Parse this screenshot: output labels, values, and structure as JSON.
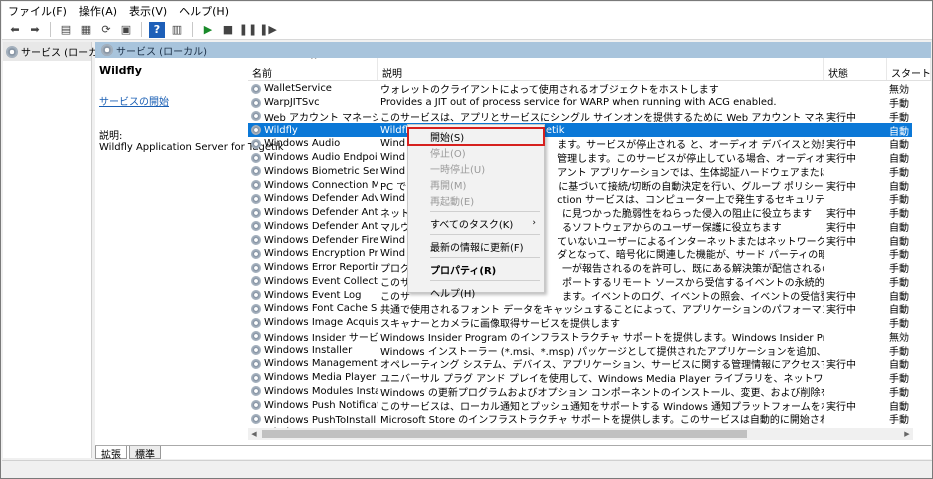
{
  "menubar": [
    "ファイル(F)",
    "操作(A)",
    "表示(V)",
    "ヘルプ(H)"
  ],
  "toolbar_icons": [
    "back-icon",
    "forward-icon",
    "console-tree-icon",
    "properties-list-icon",
    "refresh-icon",
    "export-icon",
    "help-icon",
    "show-icon",
    "start-icon",
    "stop-icon",
    "pause-icon",
    "restart-icon"
  ],
  "left_pane": {
    "label": "サービス (ローカル)"
  },
  "right_pane": {
    "header": "サービス (ローカル)"
  },
  "detail": {
    "title": "Wildfly",
    "start_link": "サービスの開始",
    "desc_label": "説明:",
    "desc_text": "Wildfly Application Server for Tagetik"
  },
  "columns": {
    "name": "名前",
    "desc": "説明",
    "status": "状態",
    "startup": "スタート"
  },
  "rows": [
    {
      "name": "WalletService",
      "desc": "ウォレットのクライアントによって使用されるオブジェクトをホストします",
      "status": "",
      "startup": "無効"
    },
    {
      "name": "WarpJITSvc",
      "desc": "Provides a JIT out of process service for WARP when running with ACG enabled.",
      "status": "",
      "startup": "手動 (ト"
    },
    {
      "name": "Web アカウント マネージャー",
      "desc": "このサービスは、アプリとサービスにシングル サインオンを提供するために Web アカウント マネージャーによって使用されます。",
      "status": "実行中",
      "startup": "手動 (ト"
    },
    {
      "name": "Wildfly",
      "desc": "Wildfly Application Server for Tagetik",
      "status": "",
      "startup": "自動"
    },
    {
      "name": "Windows Audio",
      "desc": "Wind",
      "tail": "ます。サービスが停止される と、オーディオ デバイスと効果は適切に機能しません。こ...",
      "status": "実行中",
      "startup": "自動"
    },
    {
      "name": "Windows Audio Endpoint B...",
      "desc": "Wind",
      "tail": "管理します。このサービスが停止している場合、オーディオ デバイスと効果は適切に機...",
      "status": "実行中",
      "startup": "自動"
    },
    {
      "name": "Windows Biometric Service",
      "desc": "Wind",
      "tail": "アント アプリケーションでは、生体認証ハードウェアまたはサンプルに直接アクセスせ...",
      "status": "",
      "startup": "手動 (ト"
    },
    {
      "name": "Windows Connection Mana...",
      "desc": "PC で",
      "tail": "に基づいて接続/切断の自動決定を行い、グループ ポリシー設定に基づいてネット...",
      "status": "実行中",
      "startup": "自動 (ト"
    },
    {
      "name": "Windows Defender Advance...",
      "desc": "Wind",
      "tail": "ction サービスは、コンピューター上で発生するセキュリティ イベントを監視および報告...",
      "status": "",
      "startup": "手動"
    },
    {
      "name": "Windows Defender Antivirus...",
      "desc": "ネット",
      "tail": "に見つかった脆弱性をねらった侵入の阻止に役立ちます",
      "status": "実行中",
      "startup": "手動"
    },
    {
      "name": "Windows Defender Antivirus...",
      "desc": "マルウ",
      "tail": "るソフトウェアからのユーザー保護に役立ちます",
      "status": "実行中",
      "startup": "自動"
    },
    {
      "name": "Windows Defender Firewall",
      "desc": "Wind",
      "tail": "ていないユーザーによるインターネットまたはネットワーク経由のアクセスを阻止するこ...",
      "status": "実行中",
      "startup": "自動"
    },
    {
      "name": "Windows Encryption Provid...",
      "desc": "Wind",
      "tail": "ダとなって、暗号化に関連した機能が、サード パーティの暗号化プロバイダーから、E...",
      "status": "",
      "startup": "手動 (ト"
    },
    {
      "name": "Windows Error Reporting Se...",
      "desc": "プログ",
      "tail": "一が報告されるのを許可し、既にある解決策が配信されるのを許可します。また、...",
      "status": "",
      "startup": "手動 (ト"
    },
    {
      "name": "Windows Event Collector",
      "desc": "このサ",
      "tail": "ポートするリモート ソースから受信するイベントの永続的サブスクリプションを管理し...",
      "status": "",
      "startup": "手動"
    },
    {
      "name": "Windows Event Log",
      "desc": "このサ",
      "tail": "ます。イベントのログ、イベントの照会、イベントの受信登録、イベント ログのアーカイ...",
      "status": "実行中",
      "startup": "自動"
    },
    {
      "name": "Windows Font Cache Service",
      "desc": "共通で使用されるフォント データをキャッシュすることによって、アプリケーションのパフォーマンスを最適化します。このサービスがまだ実行...",
      "status": "実行中",
      "startup": "自動"
    },
    {
      "name": "Windows Image Acquisition ...",
      "desc": "スキャナーとカメラに画像取得サービスを提供します",
      "status": "",
      "startup": "手動"
    },
    {
      "name": "Windows Insider サービス",
      "desc": "Windows Insider Program のインフラストラクチャ サポートを提供します。Windows Insider Program が機能するためには、このサ...",
      "status": "",
      "startup": "無効"
    },
    {
      "name": "Windows Installer",
      "desc": "Windows インストーラー (*.msi、*.msp) パッケージとして提供されたアプリケーションを追加、修正、および削除します。このサービスが...",
      "status": "",
      "startup": "手動"
    },
    {
      "name": "Windows Management Instr...",
      "desc": "オペレーティング システム、デバイス、アプリケーション、サービスに関する管理情報にアクセスするための共通インターフェイスとオブジェクト...",
      "status": "実行中",
      "startup": "自動"
    },
    {
      "name": "Windows Media Player Netw...",
      "desc": "ユニバーサル プラグ アンド プレイを使用して、Windows Media Player ライブラリを、ネットワーク接続された他のプレーヤーやメディア デ...",
      "status": "",
      "startup": "手動"
    },
    {
      "name": "Windows Modules Installer",
      "desc": "Windows の更新プログラムおよびオプション コンポーネントのインストール、変更、および削除を可能にします。このサービスを無効にし...",
      "status": "",
      "startup": "手動"
    },
    {
      "name": "Windows Push Notifications...",
      "desc": "このサービスは、ローカル通知とプッシュ通知をサポートする Windows 通知プラットフォームをホストします。タイル通知、トースト通知、未...",
      "status": "実行中",
      "startup": "自動"
    },
    {
      "name": "Windows PushToInstall サービス",
      "desc": "Microsoft Store のインフラストラクチャ サポートを提供します。このサービスは自動的に開始されます。無効にすると、リモート インスト...",
      "status": "",
      "startup": "手動 (ト"
    },
    {
      "name": "Windows Remote Managem...",
      "desc": "Windows リモート管理 (WinRM) サービスは、リモート管理用の WS-Management プロトコルを実装しています。WS-Manageme...",
      "status": "実行中",
      "startup": "手動"
    }
  ],
  "context_menu": {
    "start": "開始(S)",
    "stop": "停止(O)",
    "pause": "一時停止(U)",
    "resume": "再開(M)",
    "restart": "再起動(E)",
    "all_tasks": "すべてのタスク(K)",
    "refresh": "最新の情報に更新(F)",
    "properties": "プロパティ(R)",
    "help": "ヘルプ(H)"
  },
  "tabs": [
    "拡張",
    "標準"
  ],
  "colors": {
    "selection": "#0b78d7",
    "header_band": "#a8c4dc",
    "highlight_box": "#d6201e",
    "link": "#1a5fb4"
  }
}
